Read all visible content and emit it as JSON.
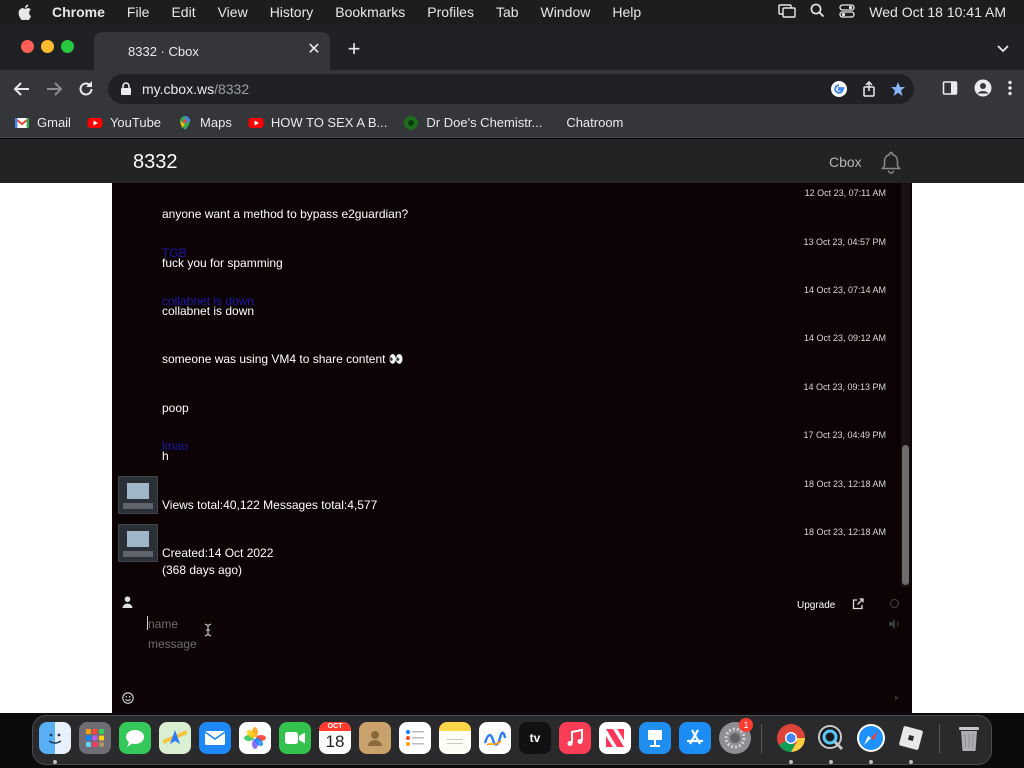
{
  "menubar": {
    "app": "Chrome",
    "items": [
      "File",
      "Edit",
      "View",
      "History",
      "Bookmarks",
      "Profiles",
      "Tab",
      "Window",
      "Help"
    ],
    "clock": "Wed Oct 18  10:41 AM"
  },
  "browser": {
    "tab_title": "8332 · Cbox",
    "url_host": "my.cbox.ws",
    "url_path": "/8332",
    "bookmarks": [
      {
        "label": "Gmail",
        "icon": "gmail-icon"
      },
      {
        "label": "YouTube",
        "icon": "youtube-icon"
      },
      {
        "label": "Maps",
        "icon": "maps-icon"
      },
      {
        "label": "HOW TO SEX A B...",
        "icon": "youtube-icon"
      },
      {
        "label": "Dr Doe's Chemistr...",
        "icon": "site-icon"
      },
      {
        "label": "Chatroom",
        "icon": "none"
      }
    ]
  },
  "site": {
    "title": "8332",
    "brand": "Cbox"
  },
  "messages": [
    {
      "time": "12 Oct 23, 07:11 AM",
      "name": "",
      "text": "anyone want a method to bypass e2guardian?",
      "avatar": false
    },
    {
      "time": "13 Oct 23, 04:57 PM",
      "name": "TGB",
      "text": "fuck you for spamming",
      "avatar": false
    },
    {
      "time": "14 Oct 23, 07:14 AM",
      "name": "collabnet is down",
      "text": "collabnet is down",
      "avatar": false
    },
    {
      "time": "14 Oct 23, 09:12 AM",
      "name": "",
      "text": "someone was using VM4 to share content 👀",
      "avatar": false
    },
    {
      "time": "14 Oct 23, 09:13 PM",
      "name": "",
      "text": "poop",
      "avatar": false
    },
    {
      "time": "17 Oct 23, 04:49 PM",
      "name": "lmao",
      "text": "h",
      "avatar": false
    },
    {
      "time": "18 Oct 23, 12:18 AM",
      "name": "",
      "text": "Views total:40,122 Messages total:4,577",
      "avatar": true
    },
    {
      "time": "18 Oct 23, 12:18 AM",
      "name": "",
      "text": "Created:14 Oct 2022",
      "text2": "(368 days ago)",
      "avatar": true
    }
  ],
  "chat_controls": {
    "upgrade_label": "Upgrade",
    "name_placeholder": "name",
    "message_placeholder": "message"
  },
  "dock": {
    "calendar_month": "OCT",
    "calendar_day": "18",
    "settings_badge": "1",
    "tv_label": "tv",
    "apps": [
      "Finder",
      "Launchpad",
      "Messages",
      "Maps",
      "Mail",
      "Photos",
      "FaceTime",
      "Calendar",
      "Contacts",
      "Reminders",
      "Notes",
      "Freeform",
      "TV",
      "Music",
      "News",
      "Keynote",
      "App Store",
      "System Settings",
      "Chrome",
      "QuickTime",
      "Safari",
      "Roblox",
      "Trash"
    ]
  },
  "colors": {
    "chat_bg": "#0d0204",
    "name_color": "#1a1aa8",
    "header_bg": "#232323"
  }
}
